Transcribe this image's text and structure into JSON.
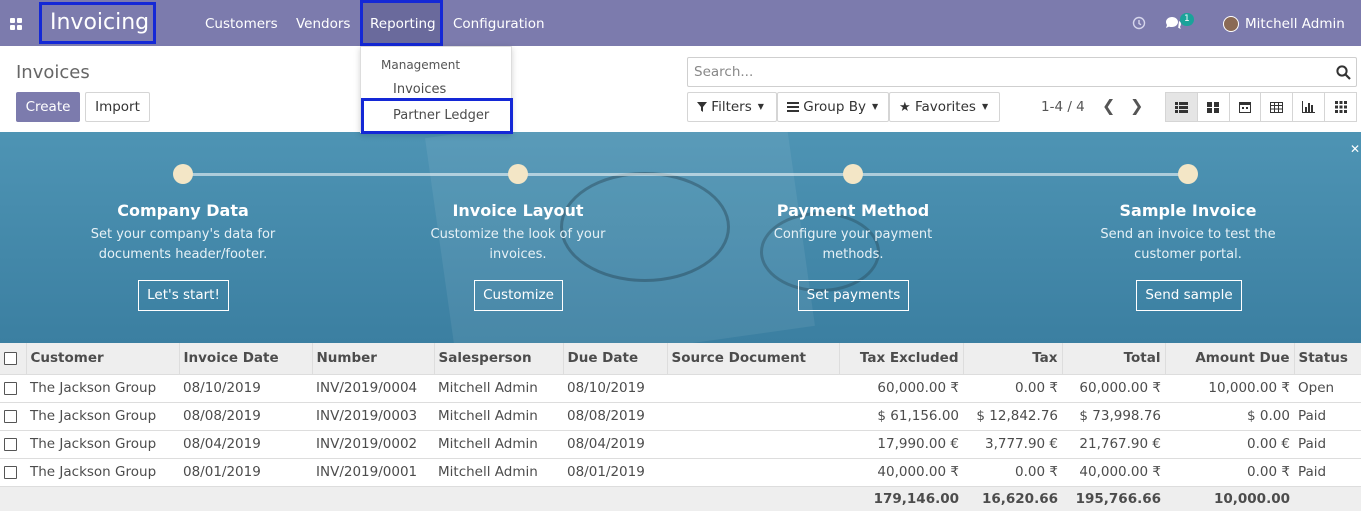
{
  "topbar": {
    "app_name": "Invoicing",
    "menu": [
      "Customers",
      "Vendors",
      "Reporting",
      "Configuration"
    ],
    "chat_badge": "1",
    "user": "Mitchell Admin"
  },
  "reporting_dropdown": {
    "section": "Management",
    "items": [
      "Invoices",
      "Partner Ledger"
    ]
  },
  "control_panel": {
    "title": "Invoices",
    "create": "Create",
    "import": "Import",
    "search_placeholder": "Search...",
    "filters": "Filters",
    "group_by": "Group By",
    "favorites": "Favorites",
    "pager": "1-4 / 4"
  },
  "onboarding": {
    "steps": [
      {
        "title": "Company Data",
        "desc1": "Set your company's data for",
        "desc2": "documents header/footer.",
        "button": "Let's start!"
      },
      {
        "title": "Invoice Layout",
        "desc1": "Customize the look of your",
        "desc2": "invoices.",
        "button": "Customize"
      },
      {
        "title": "Payment Method",
        "desc1": "Configure your payment",
        "desc2": "methods.",
        "button": "Set payments"
      },
      {
        "title": "Sample Invoice",
        "desc1": "Send an invoice to test the",
        "desc2": "customer portal.",
        "button": "Send sample"
      }
    ]
  },
  "table": {
    "columns": [
      "Customer",
      "Invoice Date",
      "Number",
      "Salesperson",
      "Due Date",
      "Source Document",
      "Tax Excluded",
      "Tax",
      "Total",
      "Amount Due",
      "Status"
    ],
    "rows": [
      {
        "customer": "The Jackson Group",
        "date": "08/10/2019",
        "number": "INV/2019/0004",
        "salesperson": "Mitchell Admin",
        "due": "08/10/2019",
        "source": "",
        "tax_excluded": "60,000.00 ₹",
        "tax": "0.00 ₹",
        "total": "60,000.00 ₹",
        "amount_due": "10,000.00 ₹",
        "status": "Open"
      },
      {
        "customer": "The Jackson Group",
        "date": "08/08/2019",
        "number": "INV/2019/0003",
        "salesperson": "Mitchell Admin",
        "due": "08/08/2019",
        "source": "",
        "tax_excluded": "$ 61,156.00",
        "tax": "$ 12,842.76",
        "total": "$ 73,998.76",
        "amount_due": "$ 0.00",
        "status": "Paid"
      },
      {
        "customer": "The Jackson Group",
        "date": "08/04/2019",
        "number": "INV/2019/0002",
        "salesperson": "Mitchell Admin",
        "due": "08/04/2019",
        "source": "",
        "tax_excluded": "17,990.00 €",
        "tax": "3,777.90 €",
        "total": "21,767.90 €",
        "amount_due": "0.00 €",
        "status": "Paid"
      },
      {
        "customer": "The Jackson Group",
        "date": "08/01/2019",
        "number": "INV/2019/0001",
        "salesperson": "Mitchell Admin",
        "due": "08/01/2019",
        "source": "",
        "tax_excluded": "40,000.00 ₹",
        "tax": "0.00 ₹",
        "total": "40,000.00 ₹",
        "amount_due": "0.00 ₹",
        "status": "Paid"
      }
    ],
    "totals": {
      "tax_excluded": "179,146.00",
      "tax": "16,620.66",
      "total": "195,766.66",
      "amount_due": "10,000.00"
    }
  }
}
